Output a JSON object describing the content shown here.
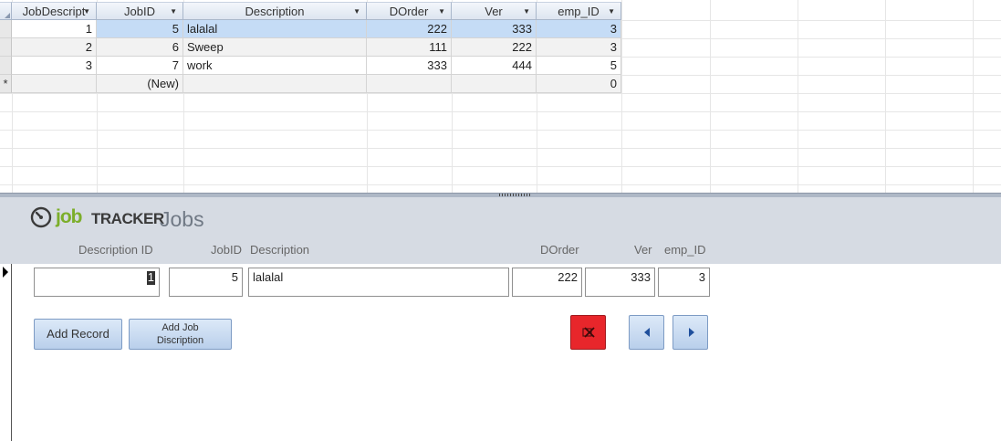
{
  "datasheet": {
    "columns": [
      "JobDescript",
      "JobID",
      "Description",
      "DOrder",
      "Ver",
      "emp_ID"
    ],
    "rows": [
      {
        "JobDescript": "1",
        "JobID": "5",
        "Description": "lalalal",
        "DOrder": "222",
        "Ver": "333",
        "emp_ID": "3"
      },
      {
        "JobDescript": "2",
        "JobID": "6",
        "Description": "Sweep",
        "DOrder": "111",
        "Ver": "222",
        "emp_ID": "3"
      },
      {
        "JobDescript": "3",
        "JobID": "7",
        "Description": "work",
        "DOrder": "333",
        "Ver": "444",
        "emp_ID": "5"
      }
    ],
    "new_row": {
      "marker": "*",
      "JobID": "(New)",
      "emp_ID": "0"
    }
  },
  "form": {
    "logo": {
      "job": "job",
      "tracker": "TRACKER"
    },
    "title": "Jobs",
    "labels": {
      "description_id": "Description ID",
      "jobid": "JobID",
      "description": "Description",
      "dorder": "DOrder",
      "ver": "Ver",
      "emp_id": "emp_ID"
    },
    "fields": {
      "description_id": "1",
      "jobid": "5",
      "description": "lalalal",
      "dorder": "222",
      "ver": "333",
      "emp_id": "3"
    },
    "buttons": {
      "add_record": "Add Record",
      "add_job_line1": "Add Job",
      "add_job_line2": "Discription"
    },
    "icons": {
      "delete": "delete-record-icon",
      "previous": "previous-record-icon",
      "next": "next-record-icon"
    },
    "colors": {
      "delete_button": "#e8262b",
      "selected_cell": "#c5dcf6",
      "header_band": "#d6dbe3",
      "logo_green": "#7cae2a"
    }
  }
}
